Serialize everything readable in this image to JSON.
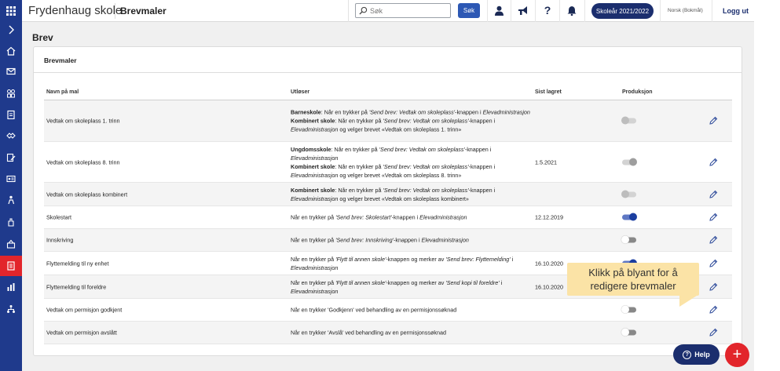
{
  "topbar": {
    "app_name": "Frydenhaug skole",
    "section": "Brevmaler",
    "search_placeholder": "Søk",
    "search_button": "Søk",
    "year_pill": "Skoleår 2021/2022",
    "language": "Norsk (Bokmål)",
    "logout": "Logg ut",
    "icons": [
      "user-icon",
      "megaphone-icon",
      "question-icon",
      "bell-icon"
    ]
  },
  "sidebar": {
    "icons": [
      "grid-icon",
      "chevron-right-icon",
      "home-icon",
      "mail-icon",
      "group-icon",
      "clipboard-icon",
      "handshake-icon",
      "document-edit-icon",
      "id-card-icon",
      "person-sitting-icon",
      "hand-icon",
      "building-icon",
      "letter-icon",
      "chart-icon",
      "network-icon"
    ],
    "active_index": 12
  },
  "page": {
    "title": "Brev",
    "card_title": "Brevmaler"
  },
  "table": {
    "headers": {
      "name": "Navn på mal",
      "trigger": "Utløser",
      "last_saved": "Sist lagret",
      "production": "Produksjon"
    },
    "rows": [
      {
        "name": "Vedtak om skoleplass 1. trinn",
        "trigger": [
          {
            "bold": "Barneskole",
            "text": ": Når en trykker på ",
            "italic": "'Send brev: Vedtak om skoleplass'",
            "text2": "-knappen i ",
            "italic2": "Elevadministrasjon",
            "text3": ""
          },
          {
            "bold": "Kombinert skole",
            "text": ": Når en trykker på ",
            "italic": "'Send brev: Vedtak om skoleplass'",
            "text2": "-knappen i ",
            "italic2": "Elevadministrasjon",
            "text3": " og velger brevet «Vedtak om skoleplass 1. trinn»"
          }
        ],
        "date": "",
        "production": "disabled"
      },
      {
        "name": "Vedtak om skoleplass 8. trinn",
        "trigger": [
          {
            "bold": "Ungdomsskole",
            "text": ": Når en trykker på ",
            "italic": "'Send brev: Vedtak om skoleplass'",
            "text2": "-knappen i ",
            "italic2": "Elevadministrasjon",
            "text3": ""
          },
          {
            "bold": "Kombinert skole",
            "text": ": Når en trykker på ",
            "italic": "'Send brev: Vedtak om skoleplass'",
            "text2": "-knappen i ",
            "italic2": "Elevadministrasjon",
            "text3": " og velger brevet «Vedtak om skoleplass 8. trinn»"
          }
        ],
        "date": "1.5.2021",
        "production": "disabled-on"
      },
      {
        "name": "Vedtak om skoleplass kombinert",
        "trigger": [
          {
            "bold": "Kombinert skole",
            "text": ": Når en trykker på ",
            "italic": "'Send brev: Vedtak om skoleplass'",
            "text2": "-knappen i ",
            "italic2": "Elevadministrasjon",
            "text3": " og velger brevet «Vedtak om skoleplass kombinert»"
          }
        ],
        "date": "",
        "production": "disabled"
      },
      {
        "name": "Skolestart",
        "trigger": [
          {
            "bold": "",
            "text": "Når en trykker på ",
            "italic": "'Send brev: Skolestart'",
            "text2": "-knappen i ",
            "italic2": "Elevadministrasjon",
            "text3": ""
          }
        ],
        "date": "12.12.2019",
        "production": "on"
      },
      {
        "name": "Innskriving",
        "trigger": [
          {
            "bold": "",
            "text": "Når en trykker på ",
            "italic": "'Send brev: Innskriving'",
            "text2": "-knappen i ",
            "italic2": "Elevadministrasjon",
            "text3": ""
          }
        ],
        "date": "",
        "production": "off"
      },
      {
        "name": "Flyttemelding til ny enhet",
        "trigger": [
          {
            "bold": "",
            "text": "Når en trykker på ",
            "italic": "'Flytt til annen skole'",
            "text2": "-knappen og merker av ",
            "italic2": "'Send brev: Flyttemelding'",
            "text3": " i "
          },
          {
            "bold": "",
            "text": "",
            "italic": "Elevadministrasjon",
            "text2": "",
            "italic2": "",
            "text3": ""
          }
        ],
        "date": "16.10.2020",
        "production": "on"
      },
      {
        "name": "Flyttemelding til foreldre",
        "trigger": [
          {
            "bold": "",
            "text": "Når en trykker på ",
            "italic": "'Flytt til annen skole'",
            "text2": "-knappen og merker av ",
            "italic2": "'Send kopi til foreldre'",
            "text3": " i "
          },
          {
            "bold": "",
            "text": "",
            "italic": "Elevadministrasjon",
            "text2": "",
            "italic2": "",
            "text3": ""
          }
        ],
        "date": "16.10.2020",
        "production": "on"
      },
      {
        "name": "Vedtak om permisjon godkjent",
        "trigger": [
          {
            "bold": "",
            "text": "Når en trykker 'Godkjenn' ved behandling av en permisjonssøknad",
            "italic": "",
            "text2": "",
            "italic2": "",
            "text3": ""
          }
        ],
        "date": "",
        "production": "off"
      },
      {
        "name": "Vedtak om permisjon avslått",
        "trigger": [
          {
            "bold": "",
            "text": "Når en trykker 'Avslå' ved behandling av en permisjonssøknad",
            "italic": "",
            "text2": "",
            "italic2": "",
            "text3": ""
          }
        ],
        "date": "",
        "production": "off"
      }
    ]
  },
  "tooltip": {
    "line1": "Klikk på blyant for å",
    "line2": "redigere brevmaler"
  },
  "help_button": "Help",
  "add_button": "+"
}
